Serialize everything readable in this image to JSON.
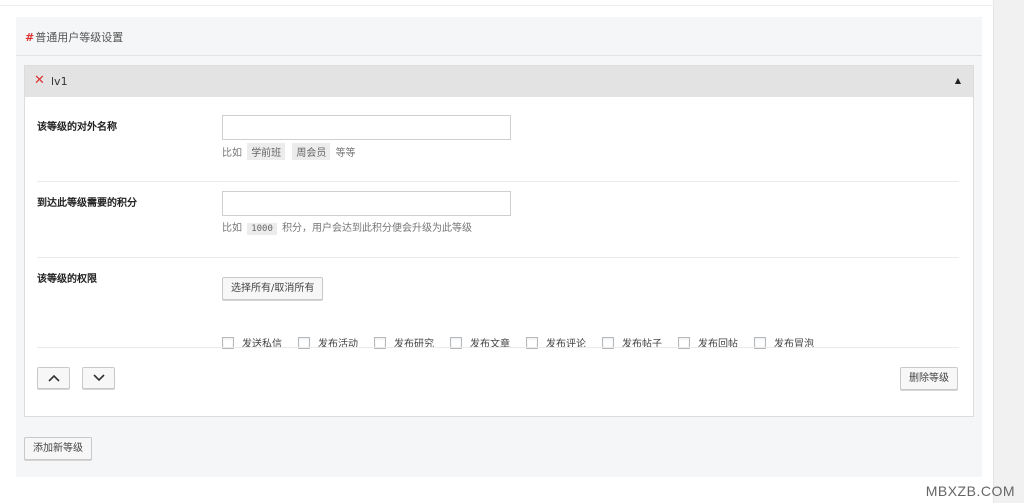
{
  "section": {
    "hash": "#",
    "title": "普通用户等级设置"
  },
  "level": {
    "name": "lv1",
    "fields": {
      "display_name": {
        "label": "该等级的对外名称",
        "value": "",
        "hint_prefix": "比如",
        "examples": [
          "学前班",
          "周会员"
        ],
        "hint_suffix": "等等"
      },
      "points": {
        "label": "到达此等级需要的积分",
        "value": "",
        "hint_prefix": "比如",
        "example": "1000",
        "hint_suffix": "积分，用户会达到此积分便会升级为此等级"
      },
      "permissions": {
        "label": "该等级的权限",
        "toggle_all_label": "选择所有/取消所有",
        "items": [
          "发送私信",
          "发布活动",
          "发布研究",
          "发布文章",
          "发布评论",
          "发布帖子",
          "发布回帖",
          "发布冒泡"
        ]
      }
    },
    "delete_label": "删除等级",
    "up_icon": "chevron-up-icon",
    "down_icon": "chevron-down-icon",
    "collapse_icon": "triangle-up-icon",
    "remove_icon": "close-icon"
  },
  "add_level_label": "添加新等级",
  "watermark": "MBXZB.COM",
  "colors": {
    "accent_red": "#dd3333",
    "header_bg": "#e3e3e3",
    "section_bg": "#f5f6f8"
  }
}
